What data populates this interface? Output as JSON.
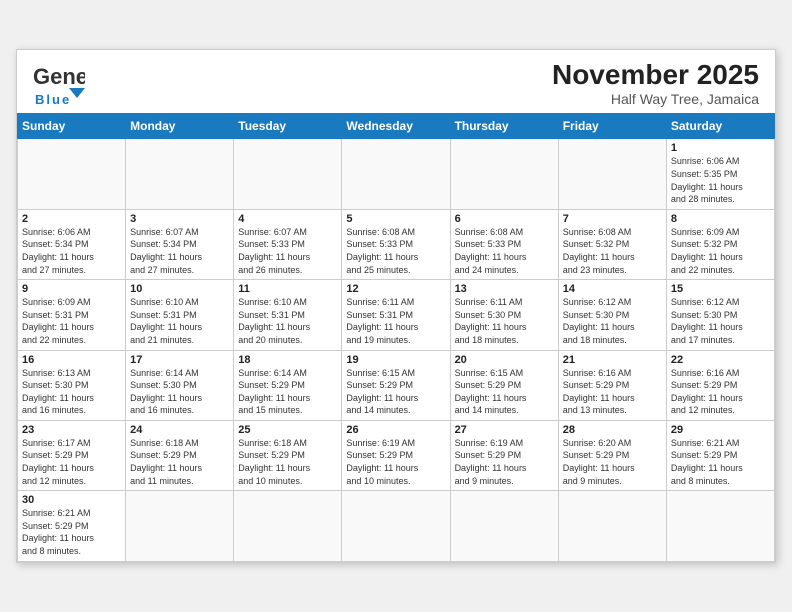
{
  "header": {
    "title": "November 2025",
    "location": "Half Way Tree, Jamaica",
    "logo_general": "General",
    "logo_blue": "Blue"
  },
  "weekdays": [
    "Sunday",
    "Monday",
    "Tuesday",
    "Wednesday",
    "Thursday",
    "Friday",
    "Saturday"
  ],
  "weeks": [
    [
      {
        "day": "",
        "info": ""
      },
      {
        "day": "",
        "info": ""
      },
      {
        "day": "",
        "info": ""
      },
      {
        "day": "",
        "info": ""
      },
      {
        "day": "",
        "info": ""
      },
      {
        "day": "",
        "info": ""
      },
      {
        "day": "1",
        "info": "Sunrise: 6:06 AM\nSunset: 5:35 PM\nDaylight: 11 hours\nand 28 minutes."
      }
    ],
    [
      {
        "day": "2",
        "info": "Sunrise: 6:06 AM\nSunset: 5:34 PM\nDaylight: 11 hours\nand 27 minutes."
      },
      {
        "day": "3",
        "info": "Sunrise: 6:07 AM\nSunset: 5:34 PM\nDaylight: 11 hours\nand 27 minutes."
      },
      {
        "day": "4",
        "info": "Sunrise: 6:07 AM\nSunset: 5:33 PM\nDaylight: 11 hours\nand 26 minutes."
      },
      {
        "day": "5",
        "info": "Sunrise: 6:08 AM\nSunset: 5:33 PM\nDaylight: 11 hours\nand 25 minutes."
      },
      {
        "day": "6",
        "info": "Sunrise: 6:08 AM\nSunset: 5:33 PM\nDaylight: 11 hours\nand 24 minutes."
      },
      {
        "day": "7",
        "info": "Sunrise: 6:08 AM\nSunset: 5:32 PM\nDaylight: 11 hours\nand 23 minutes."
      },
      {
        "day": "8",
        "info": "Sunrise: 6:09 AM\nSunset: 5:32 PM\nDaylight: 11 hours\nand 22 minutes."
      }
    ],
    [
      {
        "day": "9",
        "info": "Sunrise: 6:09 AM\nSunset: 5:31 PM\nDaylight: 11 hours\nand 22 minutes."
      },
      {
        "day": "10",
        "info": "Sunrise: 6:10 AM\nSunset: 5:31 PM\nDaylight: 11 hours\nand 21 minutes."
      },
      {
        "day": "11",
        "info": "Sunrise: 6:10 AM\nSunset: 5:31 PM\nDaylight: 11 hours\nand 20 minutes."
      },
      {
        "day": "12",
        "info": "Sunrise: 6:11 AM\nSunset: 5:31 PM\nDaylight: 11 hours\nand 19 minutes."
      },
      {
        "day": "13",
        "info": "Sunrise: 6:11 AM\nSunset: 5:30 PM\nDaylight: 11 hours\nand 18 minutes."
      },
      {
        "day": "14",
        "info": "Sunrise: 6:12 AM\nSunset: 5:30 PM\nDaylight: 11 hours\nand 18 minutes."
      },
      {
        "day": "15",
        "info": "Sunrise: 6:12 AM\nSunset: 5:30 PM\nDaylight: 11 hours\nand 17 minutes."
      }
    ],
    [
      {
        "day": "16",
        "info": "Sunrise: 6:13 AM\nSunset: 5:30 PM\nDaylight: 11 hours\nand 16 minutes."
      },
      {
        "day": "17",
        "info": "Sunrise: 6:14 AM\nSunset: 5:30 PM\nDaylight: 11 hours\nand 16 minutes."
      },
      {
        "day": "18",
        "info": "Sunrise: 6:14 AM\nSunset: 5:29 PM\nDaylight: 11 hours\nand 15 minutes."
      },
      {
        "day": "19",
        "info": "Sunrise: 6:15 AM\nSunset: 5:29 PM\nDaylight: 11 hours\nand 14 minutes."
      },
      {
        "day": "20",
        "info": "Sunrise: 6:15 AM\nSunset: 5:29 PM\nDaylight: 11 hours\nand 14 minutes."
      },
      {
        "day": "21",
        "info": "Sunrise: 6:16 AM\nSunset: 5:29 PM\nDaylight: 11 hours\nand 13 minutes."
      },
      {
        "day": "22",
        "info": "Sunrise: 6:16 AM\nSunset: 5:29 PM\nDaylight: 11 hours\nand 12 minutes."
      }
    ],
    [
      {
        "day": "23",
        "info": "Sunrise: 6:17 AM\nSunset: 5:29 PM\nDaylight: 11 hours\nand 12 minutes."
      },
      {
        "day": "24",
        "info": "Sunrise: 6:18 AM\nSunset: 5:29 PM\nDaylight: 11 hours\nand 11 minutes."
      },
      {
        "day": "25",
        "info": "Sunrise: 6:18 AM\nSunset: 5:29 PM\nDaylight: 11 hours\nand 10 minutes."
      },
      {
        "day": "26",
        "info": "Sunrise: 6:19 AM\nSunset: 5:29 PM\nDaylight: 11 hours\nand 10 minutes."
      },
      {
        "day": "27",
        "info": "Sunrise: 6:19 AM\nSunset: 5:29 PM\nDaylight: 11 hours\nand 9 minutes."
      },
      {
        "day": "28",
        "info": "Sunrise: 6:20 AM\nSunset: 5:29 PM\nDaylight: 11 hours\nand 9 minutes."
      },
      {
        "day": "29",
        "info": "Sunrise: 6:21 AM\nSunset: 5:29 PM\nDaylight: 11 hours\nand 8 minutes."
      }
    ],
    [
      {
        "day": "30",
        "info": "Sunrise: 6:21 AM\nSunset: 5:29 PM\nDaylight: 11 hours\nand 8 minutes."
      },
      {
        "day": "",
        "info": ""
      },
      {
        "day": "",
        "info": ""
      },
      {
        "day": "",
        "info": ""
      },
      {
        "day": "",
        "info": ""
      },
      {
        "day": "",
        "info": ""
      },
      {
        "day": "",
        "info": ""
      }
    ]
  ]
}
